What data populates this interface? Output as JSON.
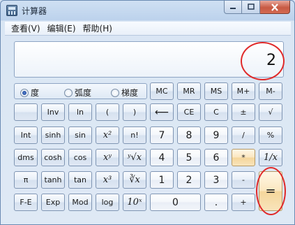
{
  "window": {
    "title": "计算器"
  },
  "menu": [
    {
      "label": "查看(V)"
    },
    {
      "label": "编辑(E)"
    },
    {
      "label": "帮助(H)"
    }
  ],
  "display": {
    "value": "2"
  },
  "angle_units": [
    {
      "label": "度",
      "selected": true
    },
    {
      "label": "弧度",
      "selected": false
    },
    {
      "label": "梯度",
      "selected": false
    }
  ],
  "buttons": {
    "mc": "MC",
    "mr": "MR",
    "ms": "MS",
    "mplus": "M+",
    "mminus": "M-",
    "inv": "Inv",
    "ln": "ln",
    "lparen": "(",
    "rparen": ")",
    "backspace": "⟵",
    "ce": "CE",
    "c": "C",
    "plusminus": "±",
    "sqrt": "√",
    "int": "Int",
    "sinh": "sinh",
    "sin": "sin",
    "x2": "x²",
    "factorial": "n!",
    "n7": "7",
    "n8": "8",
    "n9": "9",
    "divide": "/",
    "percent": "%",
    "dms": "dms",
    "cosh": "cosh",
    "cos": "cos",
    "xy": "xʸ",
    "yroot": "ʸ√x",
    "n4": "4",
    "n5": "5",
    "n6": "6",
    "multiply": "*",
    "reciprocal": "1/x",
    "pi": "π",
    "tanh": "tanh",
    "tan": "tan",
    "x3": "x³",
    "cuberoot": "∛x",
    "n1": "1",
    "n2": "2",
    "n3": "3",
    "minus": "-",
    "equals": "=",
    "fe": "F-E",
    "exp": "Exp",
    "mod": "Mod",
    "log": "log",
    "pow10": "10ˣ",
    "n0": "0",
    "dot": ".",
    "plus": "+"
  },
  "colors": {
    "annotation": "#e02a2a",
    "operator": "#f5d69b",
    "window": "#d6e4f4"
  }
}
